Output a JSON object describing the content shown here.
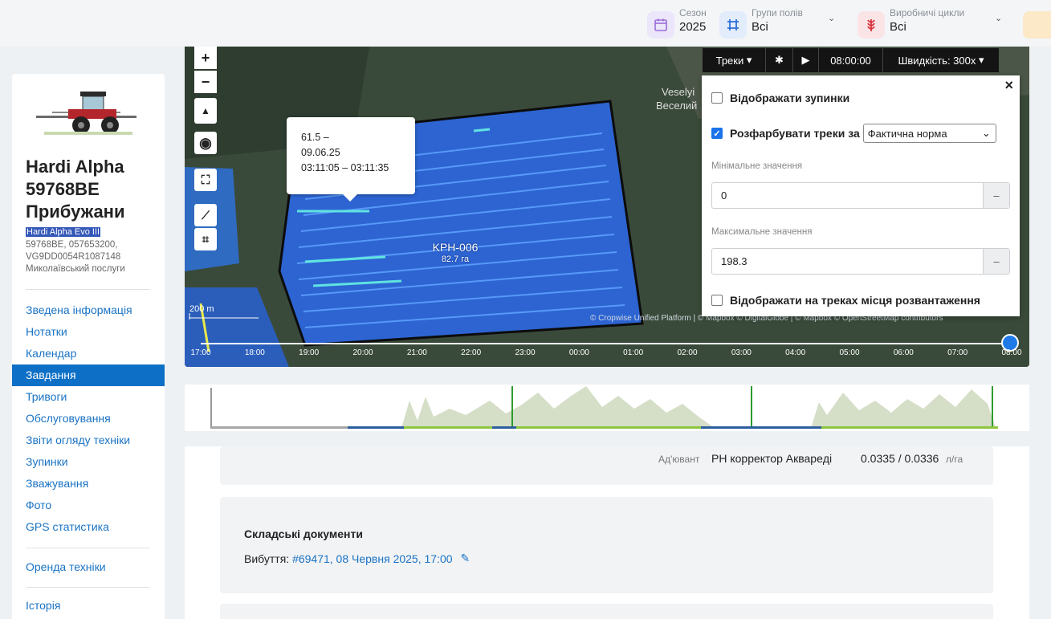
{
  "filters": [
    {
      "label": "Сезон",
      "value": "2025"
    },
    {
      "label": "Групи полів",
      "value": "Всі"
    },
    {
      "label": "Виробничі цикли",
      "value": "Всі"
    }
  ],
  "machine": {
    "title": "Hardi Alpha 59768ВЕ Прибужани",
    "model": "Hardi Alpha Evo III",
    "info": "59768ВЕ, 057653200, VG9DD0054R1087148 Миколаївський послуги"
  },
  "nav": {
    "items": [
      "Зведена інформація",
      "Нотатки",
      "Календар",
      "Завдання",
      "Тривоги",
      "Обслуговування",
      "Звіти огляду техніки",
      "Зупинки",
      "Зважування",
      "Фото",
      "GPS статистика"
    ],
    "active_index": 3,
    "rent": "Оренда техніки",
    "history": "Історія"
  },
  "map": {
    "popup": {
      "line1": "61.5 –",
      "line2": "09.06.25",
      "line3": "03:11:05 – 03:11:35"
    },
    "field_name": "KPH-006",
    "field_area": "82.7 га",
    "village": "Veselyi",
    "village_ua": "Веселий",
    "scale": "200 m",
    "attribution": "© Cropwise Unified Platform | © Mapbox © DigitalGlobe | © Mapbox © OpenStreetMap contributors",
    "toolbar": {
      "tracks": "Треки",
      "time": "08:00:00",
      "speed": "Швидкість: 300x"
    },
    "timeline": [
      "17:00",
      "18:00",
      "19:00",
      "20:00",
      "21:00",
      "22:00",
      "23:00",
      "00:00",
      "01:00",
      "02:00",
      "03:00",
      "04:00",
      "05:00",
      "06:00",
      "07:00",
      "08:00"
    ]
  },
  "settings": {
    "show_stops": "Відображати зупинки",
    "color_tracks": "Розфарбувати треки за",
    "color_by": "Фактична норма",
    "min_label": "Мінімальне значення",
    "min_value": "0",
    "max_label": "Максимальне значення",
    "max_value": "198.3",
    "show_unload": "Відображати на треках місця розвантаження",
    "minus": "–",
    "close": "×"
  },
  "task": {
    "adjuvant_label": "Ад'ювант",
    "adjuvant_name": "PH корректор Акварeді",
    "adjuvant_rate": "0.0335 / 0.0336",
    "adjuvant_unit": "л/га",
    "warehouse_title": "Складські документи",
    "departure_label": "Вибуття:",
    "departure_link": "#69471, 08 Червня 2025, 17:00"
  }
}
